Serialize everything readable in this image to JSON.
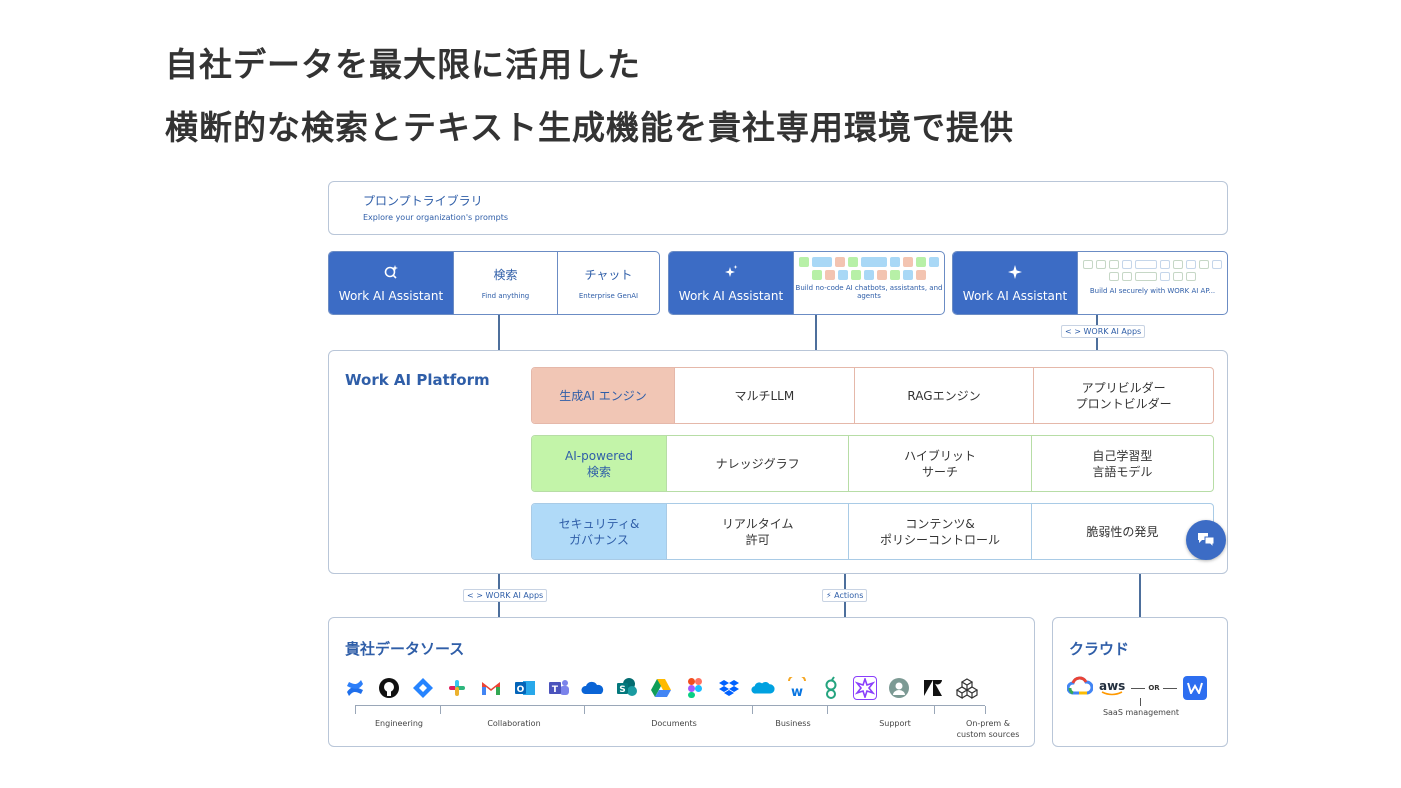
{
  "headline": {
    "line1": "自社データを最大限に活用した",
    "line2": "横断的な検索とテキスト生成機能を貴社専用環境で提供"
  },
  "prompt_library": {
    "title": "プロンプトライブラリ",
    "subtitle": "Explore your organization's prompts"
  },
  "assistants": [
    {
      "brand": "Work AI Assistant",
      "cells": [
        {
          "title": "検索",
          "sub": "Find anything"
        },
        {
          "title": "チャット",
          "sub": "Enterprise GenAI"
        }
      ]
    },
    {
      "brand": "Work AI Assistant",
      "desc": "Build no-code AI chatbots, assistants, and agents"
    },
    {
      "brand": "Work AI Assistant",
      "desc": "Build AI securely with WORK AI AP..."
    }
  ],
  "connectors": {
    "work_ai_apps_top": "WORK AI Apps",
    "work_ai_apps_bottom": "WORK AI Apps",
    "actions": "Actions"
  },
  "platform": {
    "title": "Work AI Platform",
    "rows": [
      {
        "cells": [
          "生成AI エンジン",
          "マルチLLM",
          "RAGエンジン",
          "アプリビルダー\nプロントビルダー"
        ]
      },
      {
        "cells": [
          "AI-powered\n検索",
          "ナレッジグラフ",
          "ハイブリット\nサーチ",
          "自己学習型\n言語モデル"
        ]
      },
      {
        "cells": [
          "セキュリティ&\nガバナンス",
          "リアルタイム\n許可",
          "コンテンツ&\nポリシーコントロール",
          "脆弱性の発見"
        ]
      }
    ]
  },
  "data_sources": {
    "title": "貴社データソース",
    "icons": [
      "confluence-icon",
      "github-icon",
      "jira-icon",
      "slack-icon",
      "gmail-icon",
      "outlook-icon",
      "teams-icon",
      "onedrive-icon",
      "sharepoint-icon",
      "google-drive-icon",
      "figma-icon",
      "dropbox-icon",
      "salesforce-icon",
      "workday-icon",
      "greenhouse-icon",
      "gong-icon",
      "avatar-icon",
      "zendesk-icon",
      "onprem-icon"
    ],
    "categories": [
      "Engineering",
      "Collaboration",
      "Documents",
      "Business",
      "Support",
      "On-prem &\ncustom sources"
    ]
  },
  "cloud": {
    "title": "クラウド",
    "aws": "aws",
    "or": "OR",
    "caption": "SaaS management"
  },
  "colors": {
    "brand_blue": "#3c6cc5",
    "gen_ai": "#f1c6b5",
    "search": "#c3f4a9",
    "security": "#b0daf8"
  }
}
